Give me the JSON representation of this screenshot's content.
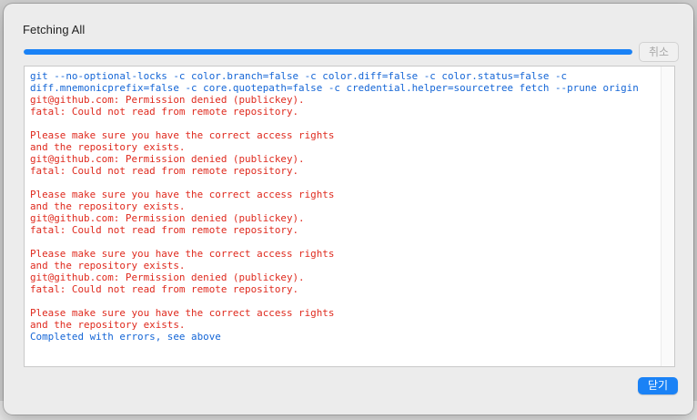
{
  "dialog": {
    "title": "Fetching All",
    "progress": 1.0,
    "cancel_label": "취소",
    "close_label": "닫기"
  },
  "log": {
    "lines": [
      {
        "kind": "cmd",
        "text": "git --no-optional-locks -c color.branch=false -c color.diff=false -c color.status=false -c"
      },
      {
        "kind": "cmd",
        "text": "diff.mnemonicprefix=false -c core.quotepath=false -c credential.helper=sourcetree fetch --prune origin"
      },
      {
        "kind": "err",
        "text": "git@github.com: Permission denied (publickey)."
      },
      {
        "kind": "err",
        "text": "fatal: Could not read from remote repository."
      },
      {
        "kind": "err",
        "text": ""
      },
      {
        "kind": "err",
        "text": "Please make sure you have the correct access rights"
      },
      {
        "kind": "err",
        "text": "and the repository exists."
      },
      {
        "kind": "err",
        "text": "git@github.com: Permission denied (publickey)."
      },
      {
        "kind": "err",
        "text": "fatal: Could not read from remote repository."
      },
      {
        "kind": "err",
        "text": ""
      },
      {
        "kind": "err",
        "text": "Please make sure you have the correct access rights"
      },
      {
        "kind": "err",
        "text": "and the repository exists."
      },
      {
        "kind": "err",
        "text": "git@github.com: Permission denied (publickey)."
      },
      {
        "kind": "err",
        "text": "fatal: Could not read from remote repository."
      },
      {
        "kind": "err",
        "text": ""
      },
      {
        "kind": "err",
        "text": "Please make sure you have the correct access rights"
      },
      {
        "kind": "err",
        "text": "and the repository exists."
      },
      {
        "kind": "err",
        "text": "git@github.com: Permission denied (publickey)."
      },
      {
        "kind": "err",
        "text": "fatal: Could not read from remote repository."
      },
      {
        "kind": "err",
        "text": ""
      },
      {
        "kind": "err",
        "text": "Please make sure you have the correct access rights"
      },
      {
        "kind": "err",
        "text": "and the repository exists."
      },
      {
        "kind": "ok",
        "text": "Completed with errors, see above"
      }
    ]
  },
  "colors": {
    "accent": "#1a82f6",
    "command_text": "#1566d6",
    "error_text": "#df2a1e"
  }
}
